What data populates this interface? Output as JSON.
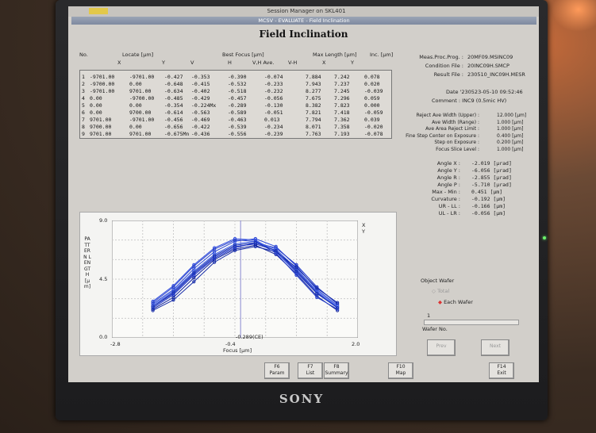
{
  "window": {
    "bg_title": "Session Manager on SKL401",
    "title": "MCSV - EVALUATE - Field Inclination",
    "main_title": "Field Inclination"
  },
  "table": {
    "headers": {
      "no": "No.",
      "locate": "Locate [µm]",
      "x": "X",
      "y": "Y",
      "v": "V",
      "best_focus": "Best Focus [µm]",
      "h": "H",
      "vh_ave": "V,H Ave.",
      "v_h": "V-H",
      "max_length": "Max Length [µm]",
      "inc": "Inc. [µm]",
      "ml_x": "X",
      "ml_y": "Y"
    },
    "rows": [
      {
        "no": "1",
        "x": "-9701.00",
        "y": "-9701.00",
        "v": "-0.427",
        "h": "-0.353",
        "ave": "-0.390",
        "vh": "-0.074",
        "mx": "7.884",
        "my": "7.242",
        "inc": "0.078"
      },
      {
        "no": "2",
        "x": "-9700.00",
        "y": "0.00",
        "v": "-0.648",
        "h": "-0.415",
        "ave": "-0.532",
        "vh": "-0.233",
        "mx": "7.943",
        "my": "7.237",
        "inc": "0.020"
      },
      {
        "no": "3",
        "x": "-9701.00",
        "y": "9701.00",
        "v": "-0.634",
        "h": "-0.402",
        "ave": "-0.518",
        "vh": "-0.232",
        "mx": "8.277",
        "my": "7.245",
        "inc": "-0.039"
      },
      {
        "no": "4",
        "x": "0.00",
        "y": "-9700.00",
        "v": "-0.485",
        "h": "-0.429",
        "ave": "-0.457",
        "vh": "-0.056",
        "mx": "7.675",
        "my": "7.296",
        "inc": "0.059"
      },
      {
        "no": "5",
        "x": "0.00",
        "y": "0.00",
        "v": "-0.354",
        "h": "-0.224Mx",
        "ave": "-0.289",
        "vh": "-0.130",
        "mx": "8.382",
        "my": "7.823",
        "inc": "0.000"
      },
      {
        "no": "6",
        "x": "0.00",
        "y": "9700.00",
        "v": "-0.614",
        "h": "-0.563",
        "ave": "-0.589",
        "vh": "-0.051",
        "mx": "7.821",
        "my": "7.418",
        "inc": "-0.059"
      },
      {
        "no": "7",
        "x": "9701.00",
        "y": "-9701.00",
        "v": "-0.456",
        "h": "-0.469",
        "ave": "-0.463",
        "vh": "0.013",
        "mx": "7.794",
        "my": "7.362",
        "inc": "0.039"
      },
      {
        "no": "8",
        "x": "9700.00",
        "y": "0.00",
        "v": "-0.656",
        "h": "-0.422",
        "ave": "-0.539",
        "vh": "-0.234",
        "mx": "8.071",
        "my": "7.358",
        "inc": "-0.020"
      },
      {
        "no": "9",
        "x": "9701.00",
        "y": "9701.00",
        "v": "-0.675Mn",
        "h": "-0.436",
        "ave": "-0.556",
        "vh": "-0.239",
        "mx": "7.763",
        "my": "7.193",
        "inc": "-0.078"
      }
    ]
  },
  "meta": {
    "proc_label": "Meas.Proc.Prog. :",
    "proc_value": "20MF09.MSINC09",
    "cond_label": "Condition File :",
    "cond_value": "20INC09H.SMCP",
    "result_label": "Result File :",
    "result_value": "230510_INC09H.MESR",
    "date": "Date '230523-05-10 09:52:46",
    "comment": "Comment : INC9 (0.5mic HV)"
  },
  "params": [
    {
      "label": "Reject Ave Width (Upper) :",
      "value": "12.000 [µm]"
    },
    {
      "label": "Ave Width (Range) :",
      "value": "1.000 [µm]"
    },
    {
      "label": "Ave Area Reject Limit :",
      "value": "1.000 [µm]"
    },
    {
      "label": "Fine Step Center on Exposure :",
      "value": "0.400 [µm]"
    },
    {
      "label": "Step on Exposure :",
      "value": "0.200 [µm]"
    },
    {
      "label": "Focus Slice Level :",
      "value": "1.000 [µm]"
    }
  ],
  "angles": [
    {
      "label": "Angle X :",
      "value": "-2.019 [µrad]"
    },
    {
      "label": "Angle Y :",
      "value": "-6.056 [µrad]"
    },
    {
      "label": "Angle R :",
      "value": "-2.855 [µrad]"
    },
    {
      "label": "Angle P :",
      "value": "-5.710 [µrad]"
    },
    {
      "label": "Max - Min :",
      "value": "0.451 [µm]"
    },
    {
      "label": "Curvature :",
      "value": "-0.192 [µm]"
    },
    {
      "label": "UR - LL :",
      "value": "-0.166 [µm]"
    },
    {
      "label": "UL - LR :",
      "value": "-0.056 [µm]"
    }
  ],
  "wafer": {
    "object_wafer": "Object Wafer",
    "total": "Total",
    "each_wafer": "Each Wafer",
    "wafer_no_value": "1",
    "wafer_no_label": "Wafer No.",
    "prev": "Prev",
    "next": "Next"
  },
  "buttons": [
    {
      "key": "F6",
      "label": "Param"
    },
    {
      "key": "F7",
      "label": "List"
    },
    {
      "key": "F8",
      "label": "Summary"
    },
    {
      "key": "F10",
      "label": "Map"
    },
    {
      "key": "F14",
      "label": "Exit"
    }
  ],
  "brand": "SONY",
  "chart_data": {
    "type": "line",
    "xlabel": "Focus [µm]",
    "ylabel": "PATTERN LENGTH [µm]",
    "ylim": [
      0.0,
      9.0
    ],
    "xlim": [
      -2.8,
      2.0
    ],
    "yticks": [
      "9.0",
      "4.5",
      "0.0"
    ],
    "xticks": [
      "-2.8",
      "-0.4",
      "2.0"
    ],
    "center_label": "-0.289(CE)",
    "legend": [
      "X",
      "Y"
    ],
    "x": [
      -2.0,
      -1.6,
      -1.2,
      -0.8,
      -0.4,
      0.0,
      0.4,
      0.8,
      1.2,
      1.6
    ],
    "series": [
      {
        "values": [
          2.4,
          3.4,
          4.9,
          6.2,
          7.0,
          7.2,
          6.7,
          5.2,
          3.5,
          2.3
        ]
      },
      {
        "values": [
          2.6,
          3.7,
          5.3,
          6.6,
          7.4,
          7.6,
          7.0,
          5.5,
          3.7,
          2.5
        ]
      },
      {
        "values": [
          2.2,
          3.1,
          4.6,
          6.0,
          6.8,
          7.1,
          6.4,
          4.9,
          3.2,
          2.1
        ]
      },
      {
        "values": [
          2.8,
          4.0,
          5.6,
          6.9,
          7.6,
          7.5,
          6.6,
          5.0,
          3.4,
          2.4
        ]
      },
      {
        "values": [
          2.3,
          3.3,
          4.8,
          6.1,
          6.9,
          7.3,
          6.9,
          5.6,
          3.9,
          2.6
        ]
      },
      {
        "values": [
          2.5,
          3.6,
          5.1,
          6.4,
          7.2,
          7.4,
          6.8,
          5.3,
          3.6,
          2.4
        ]
      },
      {
        "values": [
          2.1,
          2.9,
          4.3,
          5.8,
          6.7,
          7.0,
          6.6,
          5.4,
          3.8,
          2.7
        ]
      },
      {
        "values": [
          2.7,
          3.9,
          5.5,
          6.8,
          7.5,
          7.4,
          6.5,
          4.8,
          3.1,
          2.2
        ]
      },
      {
        "values": [
          2.4,
          3.5,
          5.0,
          6.3,
          7.1,
          7.3,
          6.7,
          5.1,
          3.4,
          2.3
        ]
      }
    ]
  }
}
